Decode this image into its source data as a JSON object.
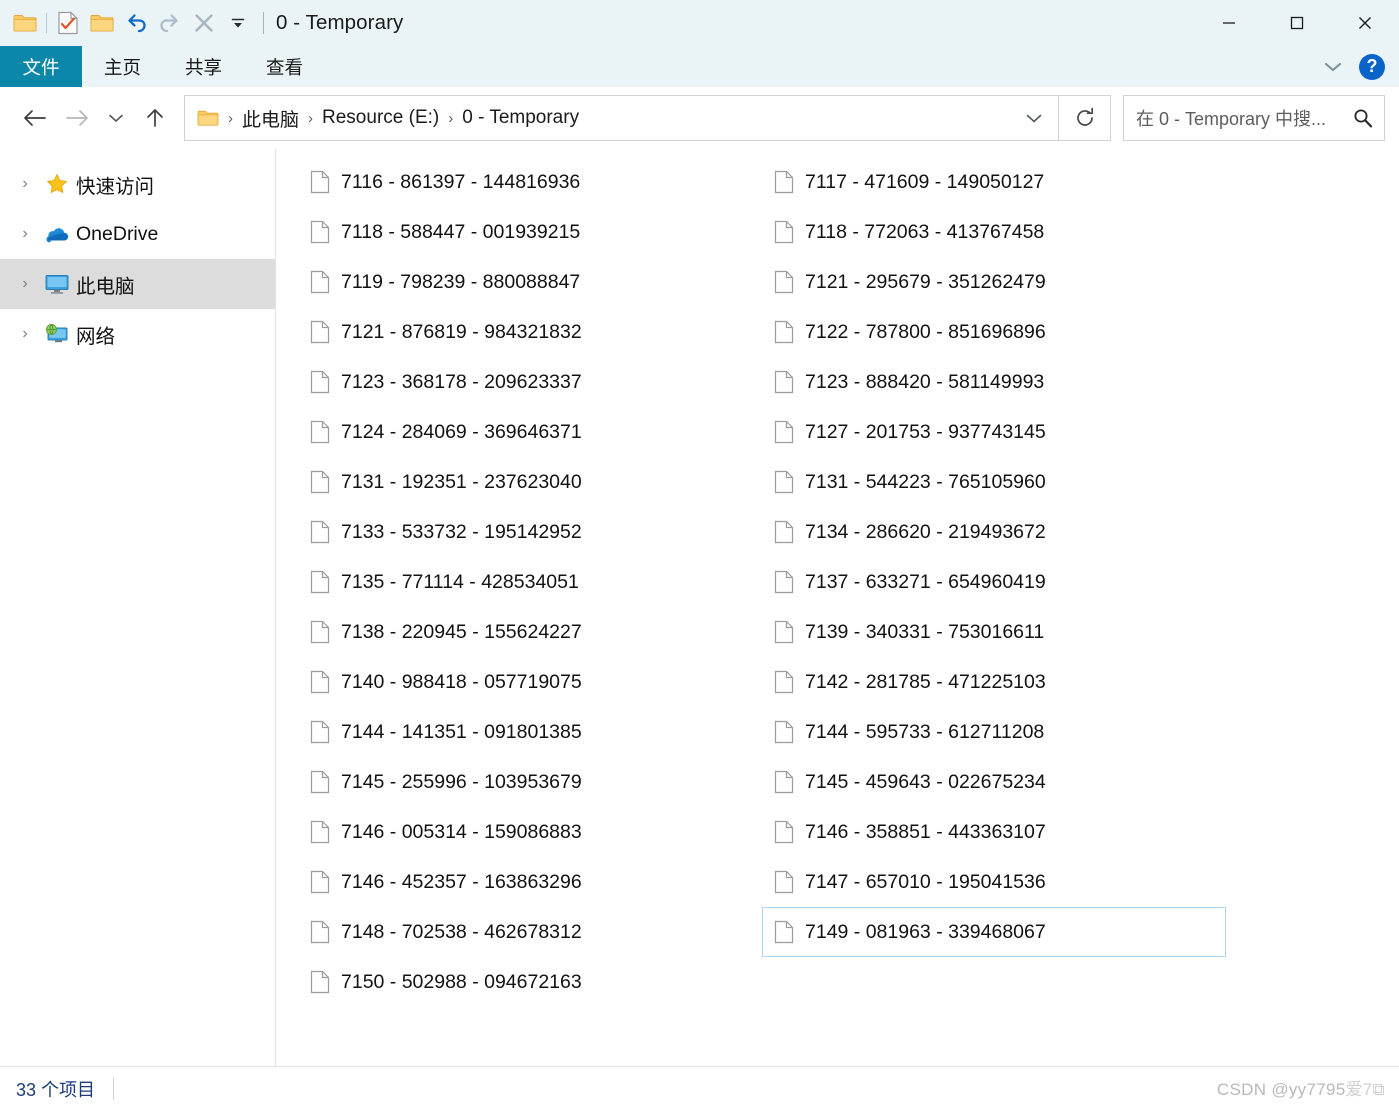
{
  "window": {
    "title": "0 - Temporary",
    "minimize_label": "—",
    "maximize_label": "□",
    "close_label": "✕"
  },
  "quick_access_toolbar": {
    "items": [
      {
        "name": "folder-icon",
        "tooltip": "自定义快速访问工具栏"
      },
      {
        "name": "properties-icon",
        "tooltip": "属性"
      },
      {
        "name": "new-folder-icon",
        "tooltip": "新建文件夹"
      },
      {
        "name": "undo-icon",
        "tooltip": "撤消"
      },
      {
        "name": "redo-icon",
        "tooltip": "恢复"
      },
      {
        "name": "delete-icon",
        "tooltip": "删除"
      },
      {
        "name": "chevron-down-icon",
        "tooltip": "自定义快速访问工具栏"
      }
    ]
  },
  "ribbon": {
    "tabs": [
      {
        "label": "文件",
        "active": true
      },
      {
        "label": "主页",
        "active": false
      },
      {
        "label": "共享",
        "active": false
      },
      {
        "label": "查看",
        "active": false
      }
    ],
    "expand_label": "⌄",
    "help_label": "?"
  },
  "navigation": {
    "back_label": "←",
    "forward_label": "→",
    "recent_label": "⌄",
    "up_label": "↑",
    "refresh_label": "⟳",
    "dropdown_label": "⌄"
  },
  "breadcrumb": {
    "separator": "›",
    "items": [
      "此电脑",
      "Resource (E:)",
      "0 - Temporary"
    ]
  },
  "search": {
    "placeholder": "在 0 - Temporary 中搜...",
    "icon": "search-icon"
  },
  "sidebar": {
    "items": [
      {
        "label": "快速访问",
        "icon": "star-icon",
        "selected": false
      },
      {
        "label": "OneDrive",
        "icon": "cloud-icon",
        "selected": false
      },
      {
        "label": "此电脑",
        "icon": "monitor-icon",
        "selected": true
      },
      {
        "label": "网络",
        "icon": "network-icon",
        "selected": false
      }
    ],
    "chevron": "›"
  },
  "files": {
    "column1": [
      "7116 - 861397 - 144816936",
      "7118 - 588447 - 001939215",
      "7119 - 798239 - 880088847",
      "7121 - 876819 - 984321832",
      "7123 - 368178 - 209623337",
      "7124 - 284069 - 369646371",
      "7131 - 192351 - 237623040",
      "7133 - 533732 - 195142952",
      "7135 - 771114 - 428534051",
      "7138 - 220945 - 155624227",
      "7140 - 988418 - 057719075",
      "7144 - 141351 - 091801385",
      "7145 - 255996 - 103953679",
      "7146 - 005314 - 159086883",
      "7146 - 452357 - 163863296",
      "7148 - 702538 - 462678312",
      "7150 - 502988 - 094672163"
    ],
    "column2": [
      "7117 - 471609 - 149050127",
      "7118 - 772063 - 413767458",
      "7121 - 295679 - 351262479",
      "7122 - 787800 - 851696896",
      "7123 - 888420 - 581149993",
      "7127 - 201753 - 937743145",
      "7131 - 544223 - 765105960",
      "7134 - 286620 - 219493672",
      "7137 - 633271 - 654960419",
      "7139 - 340331 - 753016611",
      "7142 - 281785 - 471225103",
      "7144 - 595733 - 612711208",
      "7145 - 459643 - 022675234",
      "7146 - 358851 - 443363107",
      "7147 - 657010 - 195041536",
      "7149 - 081963 - 339468067"
    ],
    "focused_item": "7149 - 081963 - 339468067"
  },
  "statusbar": {
    "item_count_text": "33 个项目"
  },
  "watermark": {
    "text": "CSDN @yy7795",
    "obscured_suffix": "爱7⧉"
  },
  "colors": {
    "titlebar_bg": "#eaf3f6",
    "file_tab": "#0c87aa",
    "selection_border": "#a8d8ef",
    "sidebar_selected": "#dcdcdc",
    "status_text": "#1b3c78"
  }
}
